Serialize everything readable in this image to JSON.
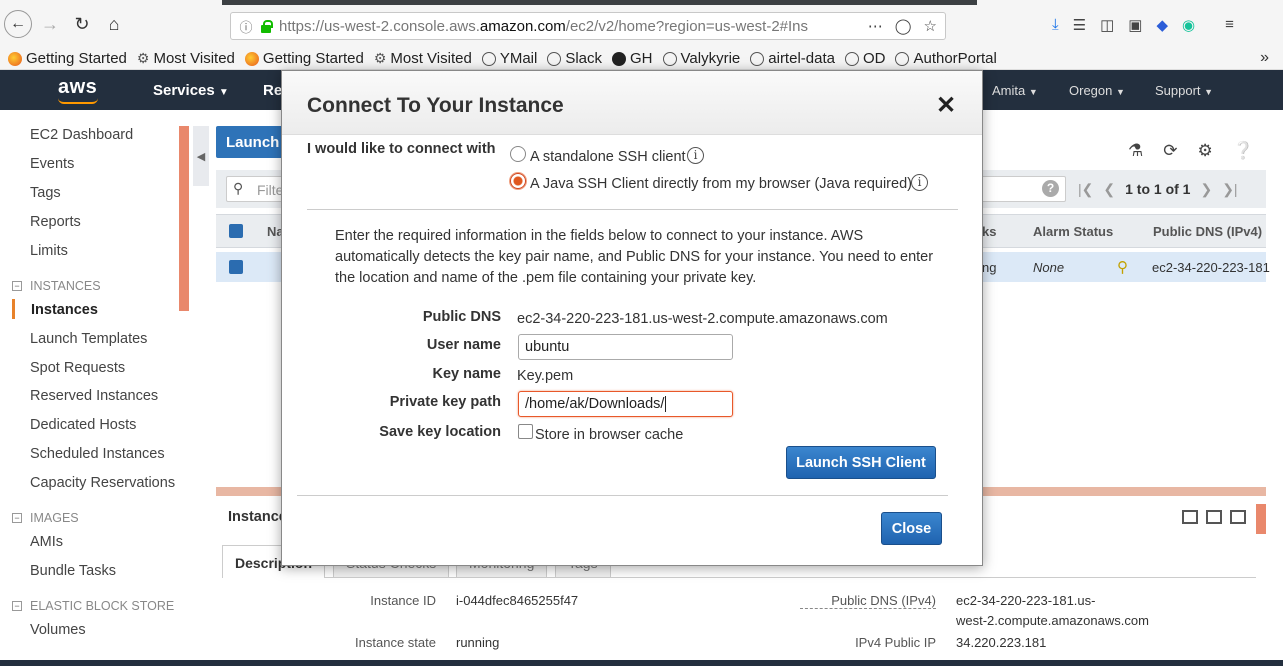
{
  "browser": {
    "url_prefix": "https://us-west-2.console.aws.",
    "url_domain": "amazon.com",
    "url_suffix": "/ec2/v2/home?region=us-west-2#Ins",
    "bookmarks": [
      {
        "label": "Getting Started",
        "icon": "firefox-icon"
      },
      {
        "label": "Most Visited",
        "icon": "gear-icon"
      },
      {
        "label": "Getting Started",
        "icon": "firefox-icon"
      },
      {
        "label": "Most Visited",
        "icon": "gear-icon"
      },
      {
        "label": "YMail",
        "icon": "globe-icon"
      },
      {
        "label": "Slack",
        "icon": "globe-icon"
      },
      {
        "label": "GH",
        "icon": "github-icon"
      },
      {
        "label": "Valykyrie",
        "icon": "globe-icon"
      },
      {
        "label": "airtel-data",
        "icon": "globe-icon"
      },
      {
        "label": "OD",
        "icon": "globe-icon"
      },
      {
        "label": "AuthorPortal",
        "icon": "globe-icon"
      }
    ]
  },
  "aws_nav": {
    "logo": "aws",
    "services": "Services",
    "resource_groups_partial": "Re",
    "user": "Amita",
    "region": "Oregon",
    "support": "Support"
  },
  "sidebar": {
    "items_top": [
      "EC2 Dashboard",
      "Events",
      "Tags",
      "Reports",
      "Limits"
    ],
    "section_instances": "INSTANCES",
    "instances_items": [
      "Instances",
      "Launch Templates",
      "Spot Requests",
      "Reserved Instances",
      "Dedicated Hosts",
      "Scheduled Instances",
      "Capacity Reservations"
    ],
    "section_images": "IMAGES",
    "images_items": [
      "AMIs",
      "Bundle Tasks"
    ],
    "section_ebs": "ELASTIC BLOCK STORE",
    "ebs_items": [
      "Volumes"
    ]
  },
  "main": {
    "launch_partial": "Launch",
    "filter_placeholder": "Filte",
    "pager_text": "1 to 1 of 1",
    "col_name_partial": "Na",
    "col_checks_partial": "ks",
    "col_alarm": "Alarm Status",
    "col_dns": "Public DNS (IPv4)",
    "row_state_partial": "ng",
    "row_alarm": "None",
    "row_dns": "ec2-34-220-223-181",
    "bottom_title_partial": "Instance",
    "tabs": [
      "Description",
      "Status Checks",
      "Monitoring",
      "Tags"
    ],
    "details": {
      "instance_id_label": "Instance ID",
      "instance_id": "i-044dfec8465255f47",
      "instance_state_label": "Instance state",
      "instance_state": "running",
      "public_dns_label": "Public DNS (IPv4)",
      "public_dns_line1": "ec2-34-220-223-181.us-",
      "public_dns_line2": "west-2.compute.amazonaws.com",
      "ipv4_label": "IPv4 Public IP",
      "ipv4": "34.220.223.181"
    }
  },
  "modal": {
    "title": "Connect To Your Instance",
    "connect_with_label": "I would like to connect with",
    "option_standalone": "A standalone SSH client",
    "option_java": "A Java SSH Client directly from my browser (Java required)",
    "selected_option": "java",
    "description": "Enter the required information in the fields below to connect to your instance. AWS automatically detects the key pair name, and Public DNS for your instance. You need to enter the location and name of the .pem file containing your private key.",
    "public_dns_label": "Public DNS",
    "public_dns_value": "ec2-34-220-223-181.us-west-2.compute.amazonaws.com",
    "user_name_label": "User name",
    "user_name_value": "ubuntu",
    "key_name_label": "Key name",
    "key_name_value": "Key.pem",
    "private_key_label": "Private key path",
    "private_key_value": "/home/ak/Downloads/",
    "save_key_label": "Save key location",
    "store_cache_label": "Store in browser cache",
    "launch_button": "Launch SSH Client",
    "close_button": "Close"
  },
  "colors": {
    "aws_nav_bg": "#232f3e",
    "aws_orange": "#ff9900",
    "primary_blue": "#2e73b8",
    "focus_orange": "#e8582a"
  }
}
